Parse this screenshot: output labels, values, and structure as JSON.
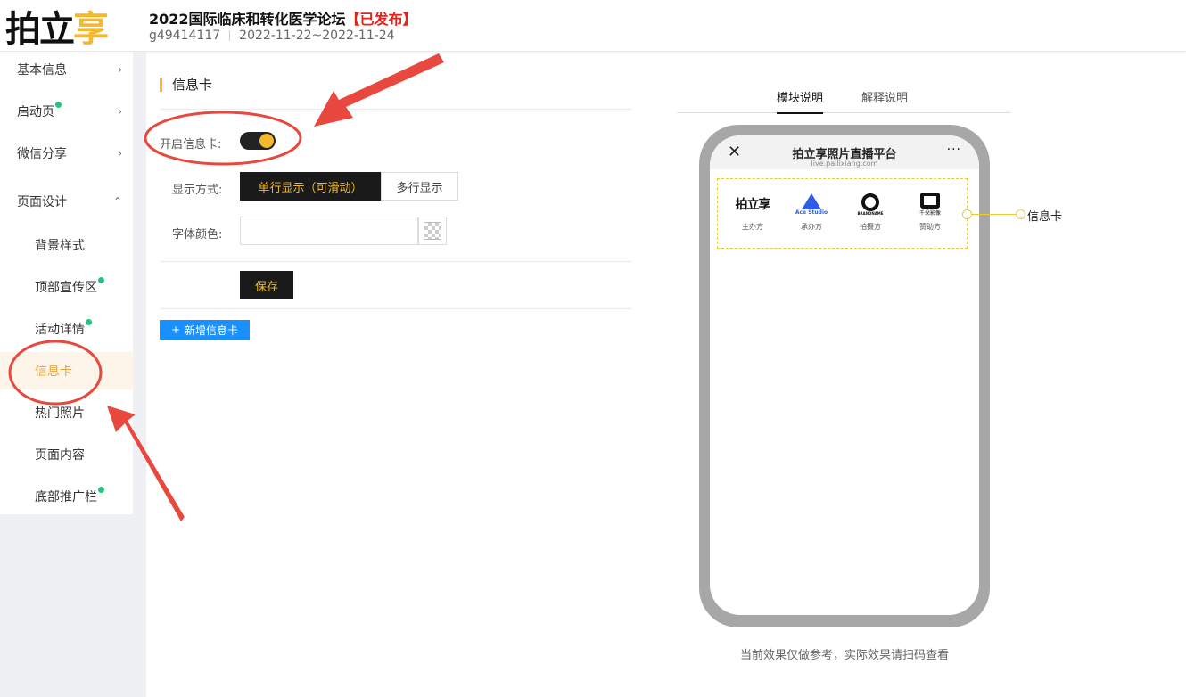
{
  "brand": {
    "logo_part1": "拍立",
    "logo_part2": "享"
  },
  "event": {
    "title": "2022国际临床和转化医学论坛",
    "status": "【已发布】",
    "id": "g49414117",
    "dates": "2022-11-22~2022-11-24"
  },
  "sidebar": {
    "items": [
      {
        "label": "基本信息",
        "chevron": "›",
        "dot": false
      },
      {
        "label": "启动页",
        "chevron": "›",
        "dot": true
      },
      {
        "label": "微信分享",
        "chevron": "›",
        "dot": false
      },
      {
        "label": "页面设计",
        "chevron": "⌃",
        "dot": false
      },
      {
        "label": "背景样式",
        "dot": false
      },
      {
        "label": "顶部宣传区",
        "dot": true
      },
      {
        "label": "活动详情",
        "dot": true
      },
      {
        "label": "信息卡",
        "dot": false,
        "active": true
      },
      {
        "label": "热门照片",
        "dot": false
      },
      {
        "label": "页面内容",
        "dot": false
      },
      {
        "label": "底部推广栏",
        "dot": true
      }
    ]
  },
  "form": {
    "section_title": "信息卡",
    "enable_label": "开启信息卡:",
    "enable_value": true,
    "display_label": "显示方式:",
    "display_options": [
      "单行显示（可滑动）",
      "多行显示"
    ],
    "display_selected": "单行显示（可滑动）",
    "font_color_label": "字体颜色:",
    "font_color_value": "",
    "save_label": "保存",
    "add_label": "新增信息卡",
    "add_icon": "+"
  },
  "preview": {
    "tabs": [
      "模块说明",
      "解释说明"
    ],
    "active_tab": "模块说明",
    "phone_close": "✕",
    "phone_title": "拍立享照片直播平台",
    "phone_url": "live.pailixiang.com",
    "phone_more": "···",
    "cards": [
      {
        "logo_text": "拍立享",
        "label": "主办方",
        "icon": "pailixiang-logo"
      },
      {
        "logo_text": "Ace Studio",
        "label": "承办方",
        "icon": "ace-studio-logo"
      },
      {
        "logo_text": "BRANDNAME",
        "label": "拍摄方",
        "icon": "aperture-logo"
      },
      {
        "logo_text": "千朵影像",
        "label": "赞助方",
        "icon": "qianduo-logo"
      }
    ],
    "callout_label": "信息卡",
    "note": "当前效果仅做参考，实际效果请扫码查看"
  },
  "colors": {
    "accent": "#f3b82b",
    "dark": "#1a1a1a",
    "primary_blue": "#1890ff",
    "annotation_red": "#e8483d",
    "status_red": "#e2231a"
  }
}
